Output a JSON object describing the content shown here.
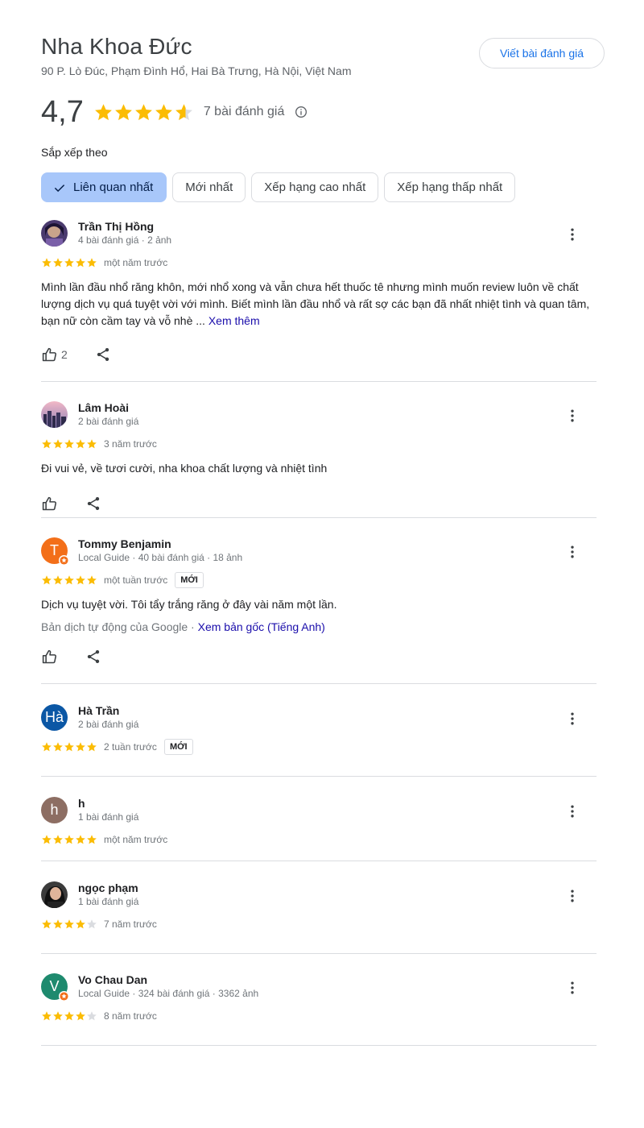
{
  "place": {
    "name": "Nha Khoa Đức",
    "address": "90 P. Lò Đúc, Phạm Đình Hổ, Hai Bà Trưng, Hà Nội, Việt Nam",
    "write_review_label": "Viết bài đánh giá",
    "rating": "4,7",
    "rating_value": 4.7,
    "review_count": "7 bài đánh giá"
  },
  "sort": {
    "label": "Sắp xếp theo",
    "options": [
      "Liên quan nhất",
      "Mới nhất",
      "Xếp hạng cao nhất",
      "Xếp hạng thấp nhất"
    ],
    "selected": "Liên quan nhất"
  },
  "colors": {
    "star": "#fbbc04",
    "star_empty": "#dadce0",
    "accent": "#1a73e8",
    "chip_active": "#a8c7fa",
    "link": "#1a0dab"
  },
  "reviews": [
    {
      "name": "Trần Thị Hồng",
      "meta": "4 bài đánh giá · 2 ảnh",
      "stars": 5,
      "time": "một năm trước",
      "text": "Mình lần đầu nhổ răng khôn, mới nhổ xong và vẫn chưa hết thuốc tê nhưng mình muốn review luôn về chất lượng dịch vụ quá tuyệt vời với mình. Biết mình lần đầu nhổ và rất sợ các bạn đã nhất nhiệt tình và quan tâm, bạn nữ còn cầm tay và vỗ nhè ...",
      "see_more": "Xem thêm",
      "likes": "2",
      "avatar": "photo"
    },
    {
      "name": "Lâm Hoài",
      "meta": "2 bài đánh giá",
      "stars": 5,
      "time": "3 năm trước",
      "text": "Đi vui vẻ, về tươi cười, nha khoa chất lượng và nhiệt tình",
      "avatar": "photo"
    },
    {
      "name": "Tommy Benjamin",
      "meta": "Local Guide · 40 bài đánh giá · 18 ảnh",
      "stars": 5,
      "time": "một tuần trước",
      "badge": "MỚI",
      "text": "Dịch vụ tuyệt vời. Tôi tẩy trắng răng ở đây vài năm một lần.",
      "translation_note": "Bản dịch tự động của Google · ",
      "translation_link": "Xem bản gốc (Tiếng Anh)",
      "avatar_letter": "T",
      "avatar_color": "#f36f19"
    },
    {
      "name": "Hà Trần",
      "meta": "2 bài đánh giá",
      "stars": 5,
      "time": "2 tuần trước",
      "badge": "MỚI",
      "avatar_letter": "Hà",
      "avatar_color": "#0b57a5"
    },
    {
      "name": "h",
      "meta": "1 bài đánh giá",
      "stars": 5,
      "time": "một năm trước",
      "avatar_letter": "h",
      "avatar_color": "#8d6e63"
    },
    {
      "name": "ngọc phạm",
      "meta": "1 bài đánh giá",
      "stars": 4,
      "time": "7 năm trước",
      "avatar": "photo"
    },
    {
      "name": "Vo Chau Dan",
      "meta": "Local Guide · 324 bài đánh giá · 3362 ảnh",
      "stars": 4,
      "time": "8 năm trước",
      "avatar_letter": "V",
      "avatar_color": "#1e8a6e"
    }
  ]
}
